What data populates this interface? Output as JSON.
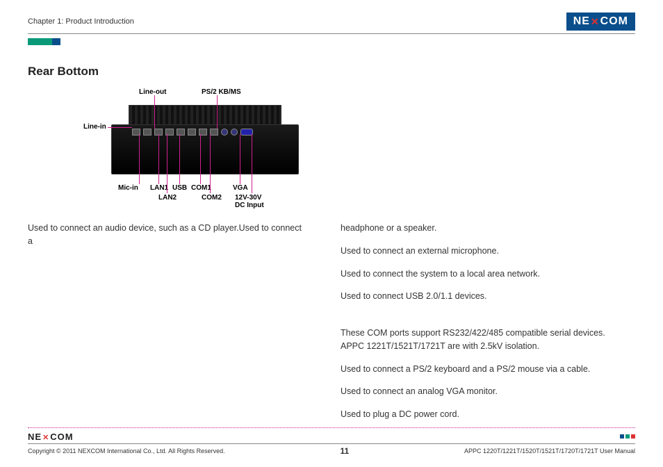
{
  "header": {
    "chapter": "Chapter 1: Product Introduction",
    "brand_left": "NE",
    "brand_x": "✕",
    "brand_right": "COM"
  },
  "section_title": "Rear Bottom",
  "diagram": {
    "labels": {
      "line_out": "Line-out",
      "ps2": "PS/2 KB/MS",
      "line_in": "Line-in",
      "mic_in": "Mic-in",
      "lan1": "LAN1",
      "usb": "USB",
      "com1": "COM1",
      "vga": "VGA",
      "lan2": "LAN2",
      "com2": "COM2",
      "dc_line1": "12V-30V",
      "dc_line2": "DC Input"
    }
  },
  "left_text": "Used to connect an audio device, such as a CD player.Used to connect a",
  "right_paragraphs": [
    "headphone or a speaker.",
    "Used to connect an external microphone.",
    "Used to connect the system to a local area network.",
    "Used to connect USB 2.0/1.1 devices.",
    "These COM ports support RS232/422/485 compatible serial devices. APPC 1221T/1521T/1721T are with 2.5kV isolation.",
    "Used to connect a PS/2 keyboard and a PS/2 mouse via a cable.",
    "Used to connect an analog VGA monitor.",
    "Used to plug a DC power cord."
  ],
  "footer": {
    "copyright": "Copyright © 2011 NEXCOM International Co., Ltd. All Rights Reserved.",
    "page": "11",
    "manual": "APPC 1220T/1221T/1520T/1521T/1720T/1721T User Manual"
  }
}
